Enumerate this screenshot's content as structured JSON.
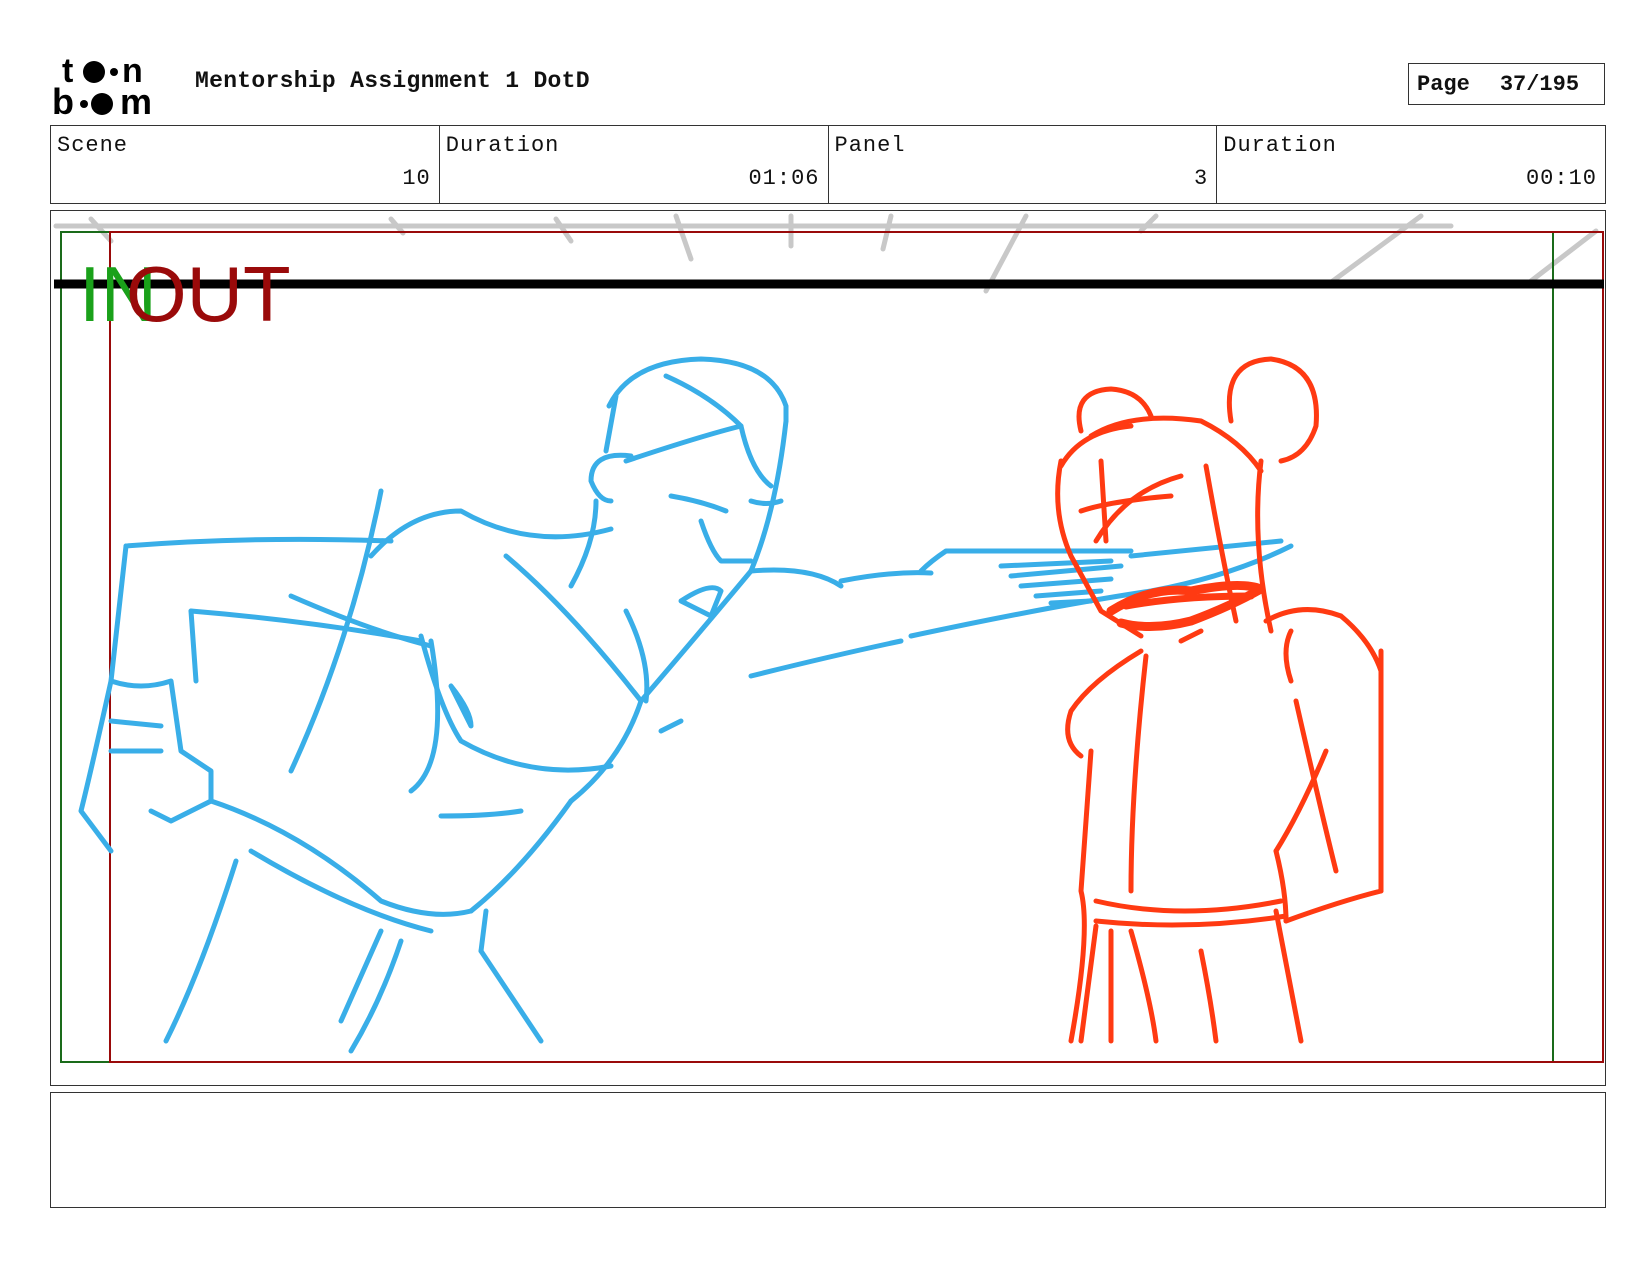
{
  "header": {
    "logo_text": "toon boom",
    "title": "Mentorship Assignment 1 DotD",
    "page_label": "Page",
    "page_value": "37/195"
  },
  "info": {
    "scene_label": "Scene",
    "scene_value": "10",
    "scene_duration_label": "Duration",
    "scene_duration_value": "01:06",
    "panel_label": "Panel",
    "panel_value": "3",
    "panel_duration_label": "Duration",
    "panel_duration_value": "00:10"
  },
  "panel": {
    "in_marker": "IN",
    "out_marker": "OUT",
    "colors": {
      "left_character": "#39aee8",
      "right_character": "#ff3a12",
      "in_frame": "#1a6b1a",
      "out_frame": "#9a0a0a",
      "horizon": "#000000",
      "background_lines": "#c8c8c8"
    }
  },
  "notes": {
    "text": ""
  }
}
